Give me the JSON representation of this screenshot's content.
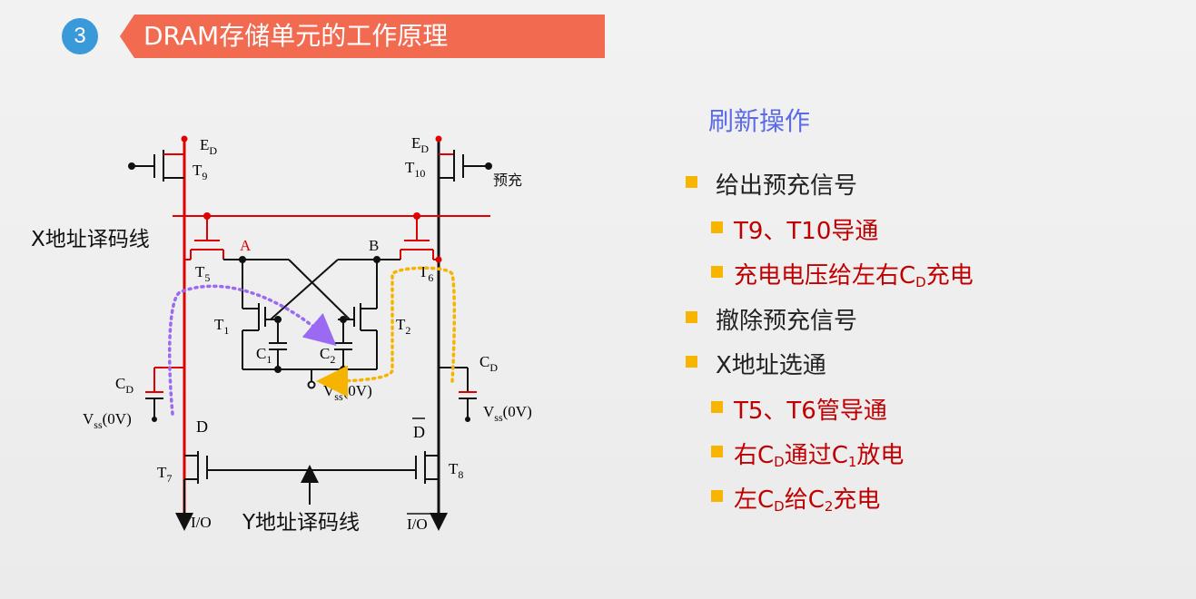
{
  "header": {
    "section_number": "3",
    "title": "DRAM存储单元的工作原理"
  },
  "circuit": {
    "x_decode_label": "X地址译码线",
    "y_decode_label": "Y地址译码线",
    "node_a": "A",
    "node_b": "B",
    "line_d": "D",
    "line_dbar": "D",
    "io": "I/O",
    "io_bar": "I/O",
    "precharge": "预充",
    "vss_mid": "(0V)",
    "vss_left": "(0V)",
    "vss_right": "(0V)",
    "colors": {
      "active": "#e00000",
      "wire": "#111111",
      "purple": "#9a6af2",
      "orange": "#f6b400"
    }
  },
  "panel": {
    "title": "刷新操作",
    "items": [
      {
        "level": 1,
        "text": "给出预充信号"
      },
      {
        "level": 2,
        "text": "T9、T10导通"
      },
      {
        "level": 2,
        "parts": [
          "充电电压给左右C",
          "D",
          "充电"
        ]
      },
      {
        "level": 1,
        "text": "撤除预充信号"
      },
      {
        "level": 1,
        "text": "X地址选通"
      },
      {
        "level": 2,
        "text": "T5、T6管导通"
      },
      {
        "level": 2,
        "parts": [
          "右C",
          "D",
          "通过C",
          "1",
          "放电"
        ]
      },
      {
        "level": 2,
        "parts": [
          "左C",
          "D",
          "给C",
          "2",
          "充电"
        ]
      }
    ]
  }
}
